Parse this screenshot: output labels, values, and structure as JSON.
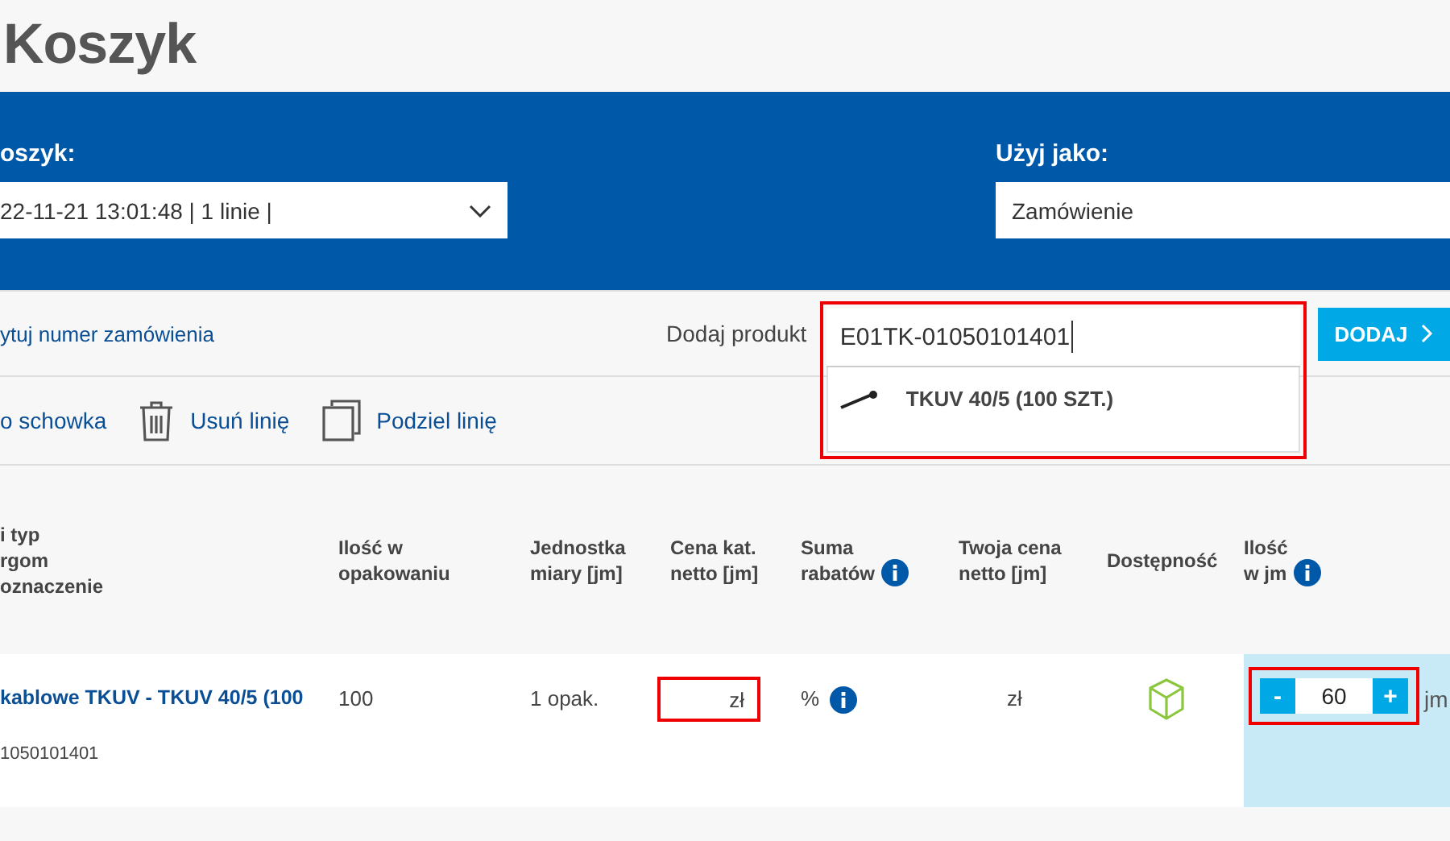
{
  "page_title": "Koszyk",
  "cart_bar": {
    "cart_label": "oszyk:",
    "cart_value": "22-11-21 13:01:48 | 1 linie |",
    "use_as_label": "Użyj jako:",
    "use_as_value": "Zamówienie"
  },
  "order_row": {
    "order_link": "ytuj numer zamówienia",
    "add_label": "Dodaj produkt",
    "search": {
      "value": "E01TK-01050101401",
      "highlighted": true
    },
    "add_button": "DODAJ",
    "suggestions": [
      {
        "label": "TKUV 40/5 (100 SZT.)"
      }
    ]
  },
  "actions": [
    {
      "kind": "clipboard",
      "label": "o schowka"
    },
    {
      "kind": "delete",
      "label": "Usuń linię"
    },
    {
      "kind": "split",
      "label": "Podziel linię"
    }
  ],
  "table": {
    "columns": [
      {
        "lines": [
          "i typ",
          "rgom",
          "oznaczenie"
        ]
      },
      {
        "lines": [
          "Ilość w",
          "opakowaniu"
        ]
      },
      {
        "lines": [
          "Jednostka",
          "miary [jm]"
        ]
      },
      {
        "lines": [
          "Cena kat.",
          "netto [jm]"
        ]
      },
      {
        "lines": [
          "Suma",
          "rabatów"
        ],
        "info": true
      },
      {
        "lines": [
          "Twoja cena",
          "netto [jm]"
        ]
      },
      {
        "lines": [
          "Dostępność"
        ]
      },
      {
        "lines": [
          "Ilość",
          "w jm"
        ],
        "info": true
      }
    ],
    "rows": [
      {
        "name": "kablowe TKUV - TKUV 40/5 (100",
        "code": "1050101401",
        "pack_qty": "100",
        "unit": "1 opak.",
        "list_price": "zł",
        "list_price_highlighted": true,
        "discount": "%",
        "your_price": "zł",
        "available": true,
        "qty": "60",
        "qty_minus": "-",
        "qty_plus": "+",
        "qty_unit": "jm",
        "qty_highlighted": true
      }
    ]
  }
}
